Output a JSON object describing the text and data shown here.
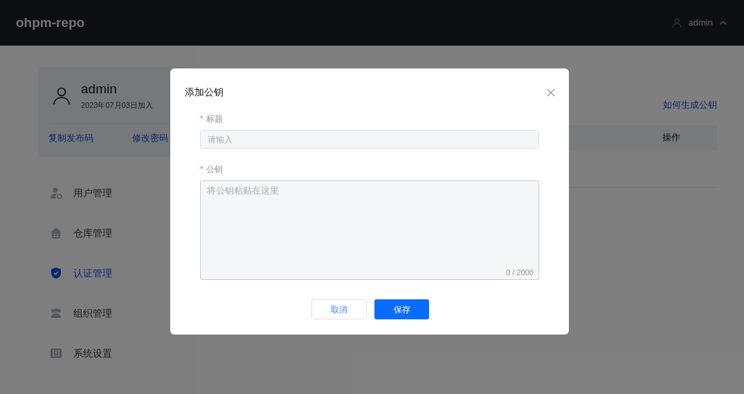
{
  "header": {
    "logo": "ohpm-repo",
    "user": "admin",
    "menu_expanded": true
  },
  "profile": {
    "name": "admin",
    "joined": "2023年07月03日加入",
    "actions": [
      "复制发布码",
      "修改密码"
    ]
  },
  "sidebar": {
    "items": [
      {
        "label": "用户管理",
        "kind": "user",
        "selected": false
      },
      {
        "label": "仓库管理",
        "kind": "warehouse",
        "selected": false
      },
      {
        "label": "认证管理",
        "kind": "shield",
        "selected": true
      },
      {
        "label": "组织管理",
        "kind": "group",
        "selected": false
      },
      {
        "label": "系统设置",
        "kind": "settings",
        "selected": false
      }
    ]
  },
  "content": {
    "help_link": "如何生成公钥",
    "table": {
      "columns": [
        "操作"
      ]
    }
  },
  "dialog": {
    "title": "添加公钥",
    "fields": [
      {
        "kind": "input",
        "required_mark": "*",
        "label": "标题",
        "placeholder": "请输入"
      },
      {
        "kind": "textarea",
        "required_mark": "*",
        "label": "公钥",
        "placeholder": "将公钥粘贴在这里",
        "counter": "0 / 2000"
      }
    ],
    "buttons": [
      {
        "label": "取消",
        "kind": "secondary"
      },
      {
        "label": "保存",
        "kind": "primary"
      }
    ]
  }
}
